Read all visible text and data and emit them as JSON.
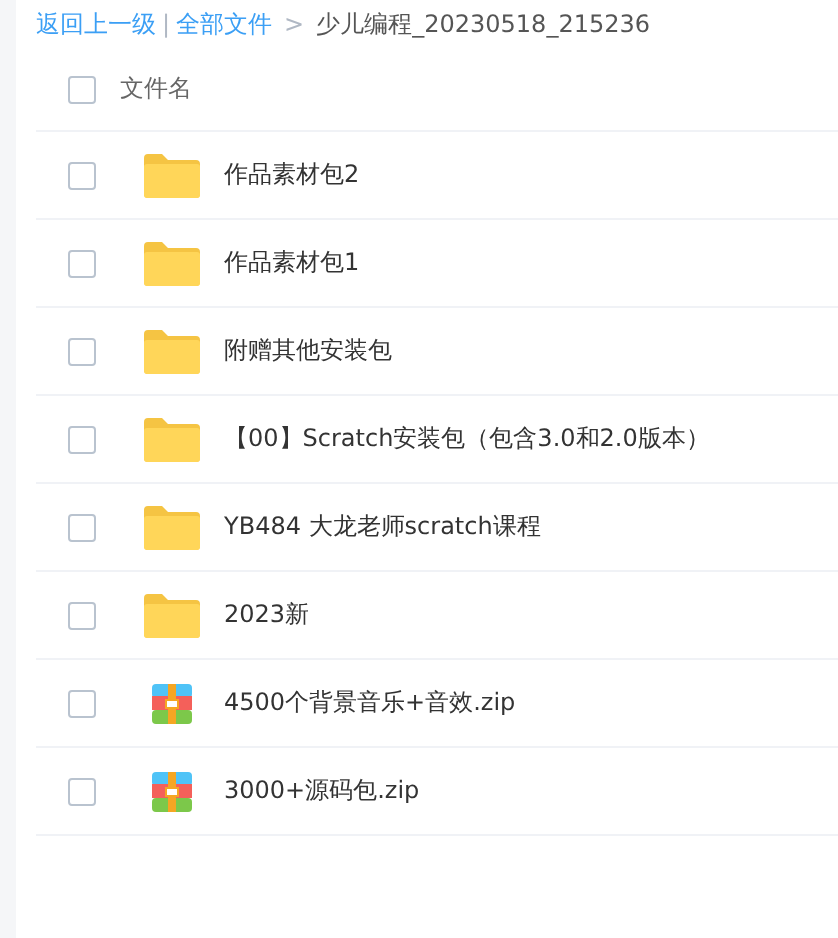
{
  "breadcrumb": {
    "back": "返回上一级",
    "separator": "|",
    "root": "全部文件",
    "arrow": ">",
    "current": "少儿编程_20230518_215236"
  },
  "header": {
    "checked": false,
    "label": "文件名"
  },
  "files": [
    {
      "kind": "folder",
      "name": "作品素材包2",
      "checked": false
    },
    {
      "kind": "folder",
      "name": "作品素材包1",
      "checked": false
    },
    {
      "kind": "folder",
      "name": "附赠其他安装包",
      "checked": false
    },
    {
      "kind": "folder",
      "name": "【00】Scratch安装包（包含3.0和2.0版本）",
      "checked": false
    },
    {
      "kind": "folder",
      "name": "YB484 大龙老师scratch课程",
      "checked": false
    },
    {
      "kind": "folder",
      "name": "2023新",
      "checked": false
    },
    {
      "kind": "zip",
      "name": "4500个背景音乐+音效.zip",
      "checked": false
    },
    {
      "kind": "zip",
      "name": "3000+源码包.zip",
      "checked": false
    }
  ]
}
